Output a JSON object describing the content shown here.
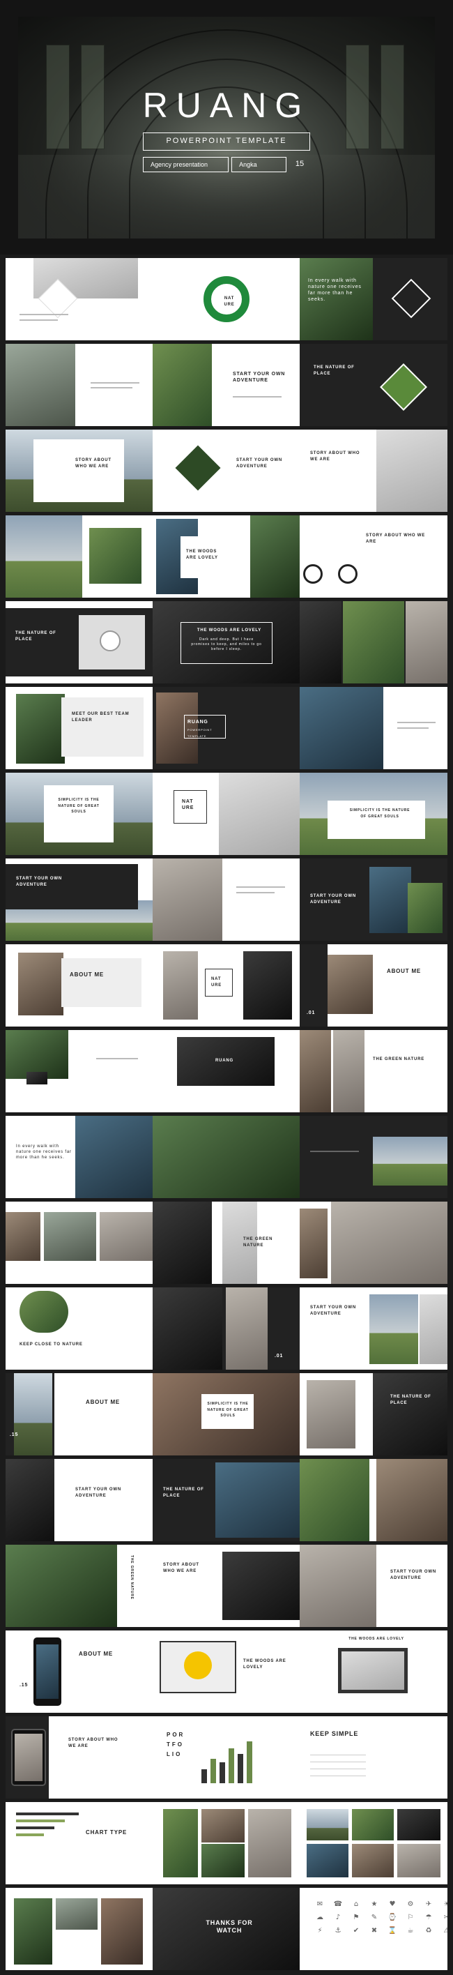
{
  "hero": {
    "title": "RUANG",
    "subtitle": "POWERPOINT TEMPLATE",
    "tag_agency": "Agency presentation",
    "tag_brand": "Angka",
    "number": "15"
  },
  "slides": {
    "s2_ring_text": "NAT URE",
    "s3_quote": "In every walk with nature one receives far more than he seeks.",
    "s4_title": "START YOUR OWN ADVENTURE",
    "s5_title": "THE NATURE OF PLACE",
    "s6_title": "STORY ABOUT WHO WE ARE",
    "s7_title": "START YOUR OWN ADVENTURE",
    "s8_title": "THE WOODS ARE LOVELY",
    "s9_title": "STORY ABOUT WHO WE ARE",
    "s10_title": "THE NATURE OF PLACE",
    "s11_title": "THE WOODS ARE LOVELY",
    "s11_body": "Dark and deep. But I have promises to keep, and miles to go before I sleep.",
    "s12_title": "MEET OUR BEST TEAM LEADER",
    "s13_title": "RUANG",
    "s13_sub": "POWERPOINT TEMPLATE",
    "s14_title": "SIMPLICITY IS THE NATURE OF GREAT SOULS",
    "s15_box": "NAT URE",
    "s16_title": "SIMPLICITY IS THE NATURE OF GREAT SOULS",
    "s17_title": "START YOUR OWN ADVENTURE",
    "s18_title": "START YOUR OWN ADVENTURE",
    "s19_title": "ABOUT ME",
    "s20_box": "NAT URE",
    "s21_title": "ABOUT ME",
    "s21_num": ".01",
    "s22_title": "THE GREEN NATURE",
    "s23_title": "RUANG",
    "s24_quote": "In every walk with nature one receives far more than he seeks.",
    "s25_title": "RUANG",
    "s26_title": "THE GREEN NATURE",
    "s27_title": "KEEP CLOSE TO NATURE",
    "s28_num": ".01",
    "s29_title": "START YOUR OWN ADVENTURE",
    "s30_title": "ABOUT ME",
    "s30_num": ".15",
    "s31_title": "SIMPLICITY IS THE NATURE OF GREAT SOULS",
    "s32_title": "THE NATURE OF PLACE",
    "s33_title": "START YOUR OWN ADVENTURE",
    "s34_title": "THE NATURE OF PLACE",
    "s35_vertical": "THE GREEN NATURE",
    "s36_title": "STORY ABOUT WHO WE ARE",
    "s37_title": "START YOUR OWN ADVENTURE",
    "s38_title": "ABOUT ME",
    "s38_num": ".15",
    "s39_title": "THE WOODS ARE LOVELY",
    "s40_title": "THE WOODS ARE LOVELY",
    "s41_title": "STORY ABOUT WHO WE ARE",
    "s42_letters": "POR TFO LIO",
    "s43_title": "KEEP SIMPLE",
    "s44_title": "CHART TYPE",
    "s47_title": "THANKS FOR WATCH"
  },
  "icons": [
    "✉",
    "☎",
    "⌂",
    "★",
    "♥",
    "⚙",
    "✈",
    "☀",
    "☁",
    "♪",
    "⚑",
    "✎",
    "⌚",
    "⚐",
    "☂",
    "✂",
    "⚡",
    "⚓",
    "✔",
    "✖",
    "⌛",
    "☕",
    "♻",
    "⚠"
  ]
}
